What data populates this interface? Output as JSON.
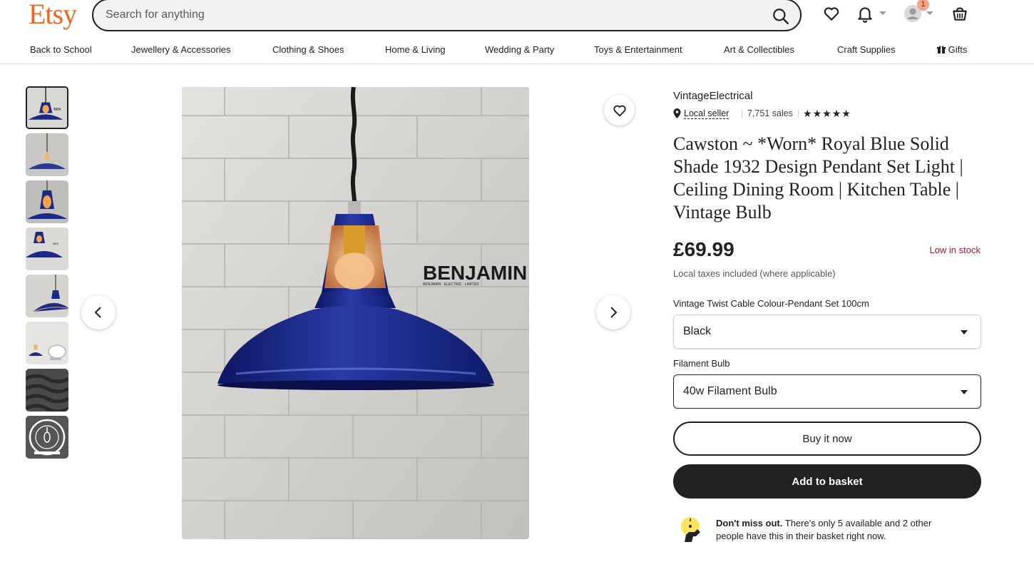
{
  "header": {
    "logo": "Etsy",
    "search_placeholder": "Search for anything",
    "notification_count": "1"
  },
  "categories": [
    "Back to School",
    "Jewellery & Accessories",
    "Clothing & Shoes",
    "Home & Living",
    "Wedding & Party",
    "Toys & Entertainment",
    "Art & Collectibles",
    "Craft Supplies",
    "Gifts"
  ],
  "gallery": {
    "watermark_brand": "BENJAMIN",
    "watermark_sub": "BENJAMIN · ELECTRIC · LIMITED"
  },
  "listing": {
    "shop_name": "VintageElectrical",
    "local_seller": "Local seller",
    "sales": "7,751 sales",
    "rating_stars": 5,
    "title": "Cawston ~ *Worn* Royal Blue Solid Shade 1932 Design Pendant Set Light | Ceiling Dining Room | Kitchen Table | Vintage Bulb",
    "price": "£69.99",
    "stock_status": "Low in stock",
    "tax_note": "Local taxes included (where applicable)"
  },
  "options": [
    {
      "label": "Vintage Twist Cable Colour-Pendant Set 100cm",
      "value": "Black"
    },
    {
      "label": "Filament Bulb",
      "value": "40w Filament Bulb"
    }
  ],
  "actions": {
    "buy_now": "Buy it now",
    "add_to_basket": "Add to basket"
  },
  "scarcity": {
    "bold": "Don't miss out.",
    "text": " There's only 5 available and 2 other people have this in their basket right now."
  },
  "colors": {
    "brand": "#f1641e",
    "stock": "#a61a2e",
    "dark_button": "#222222",
    "shade_blue": "#1c2a86"
  }
}
